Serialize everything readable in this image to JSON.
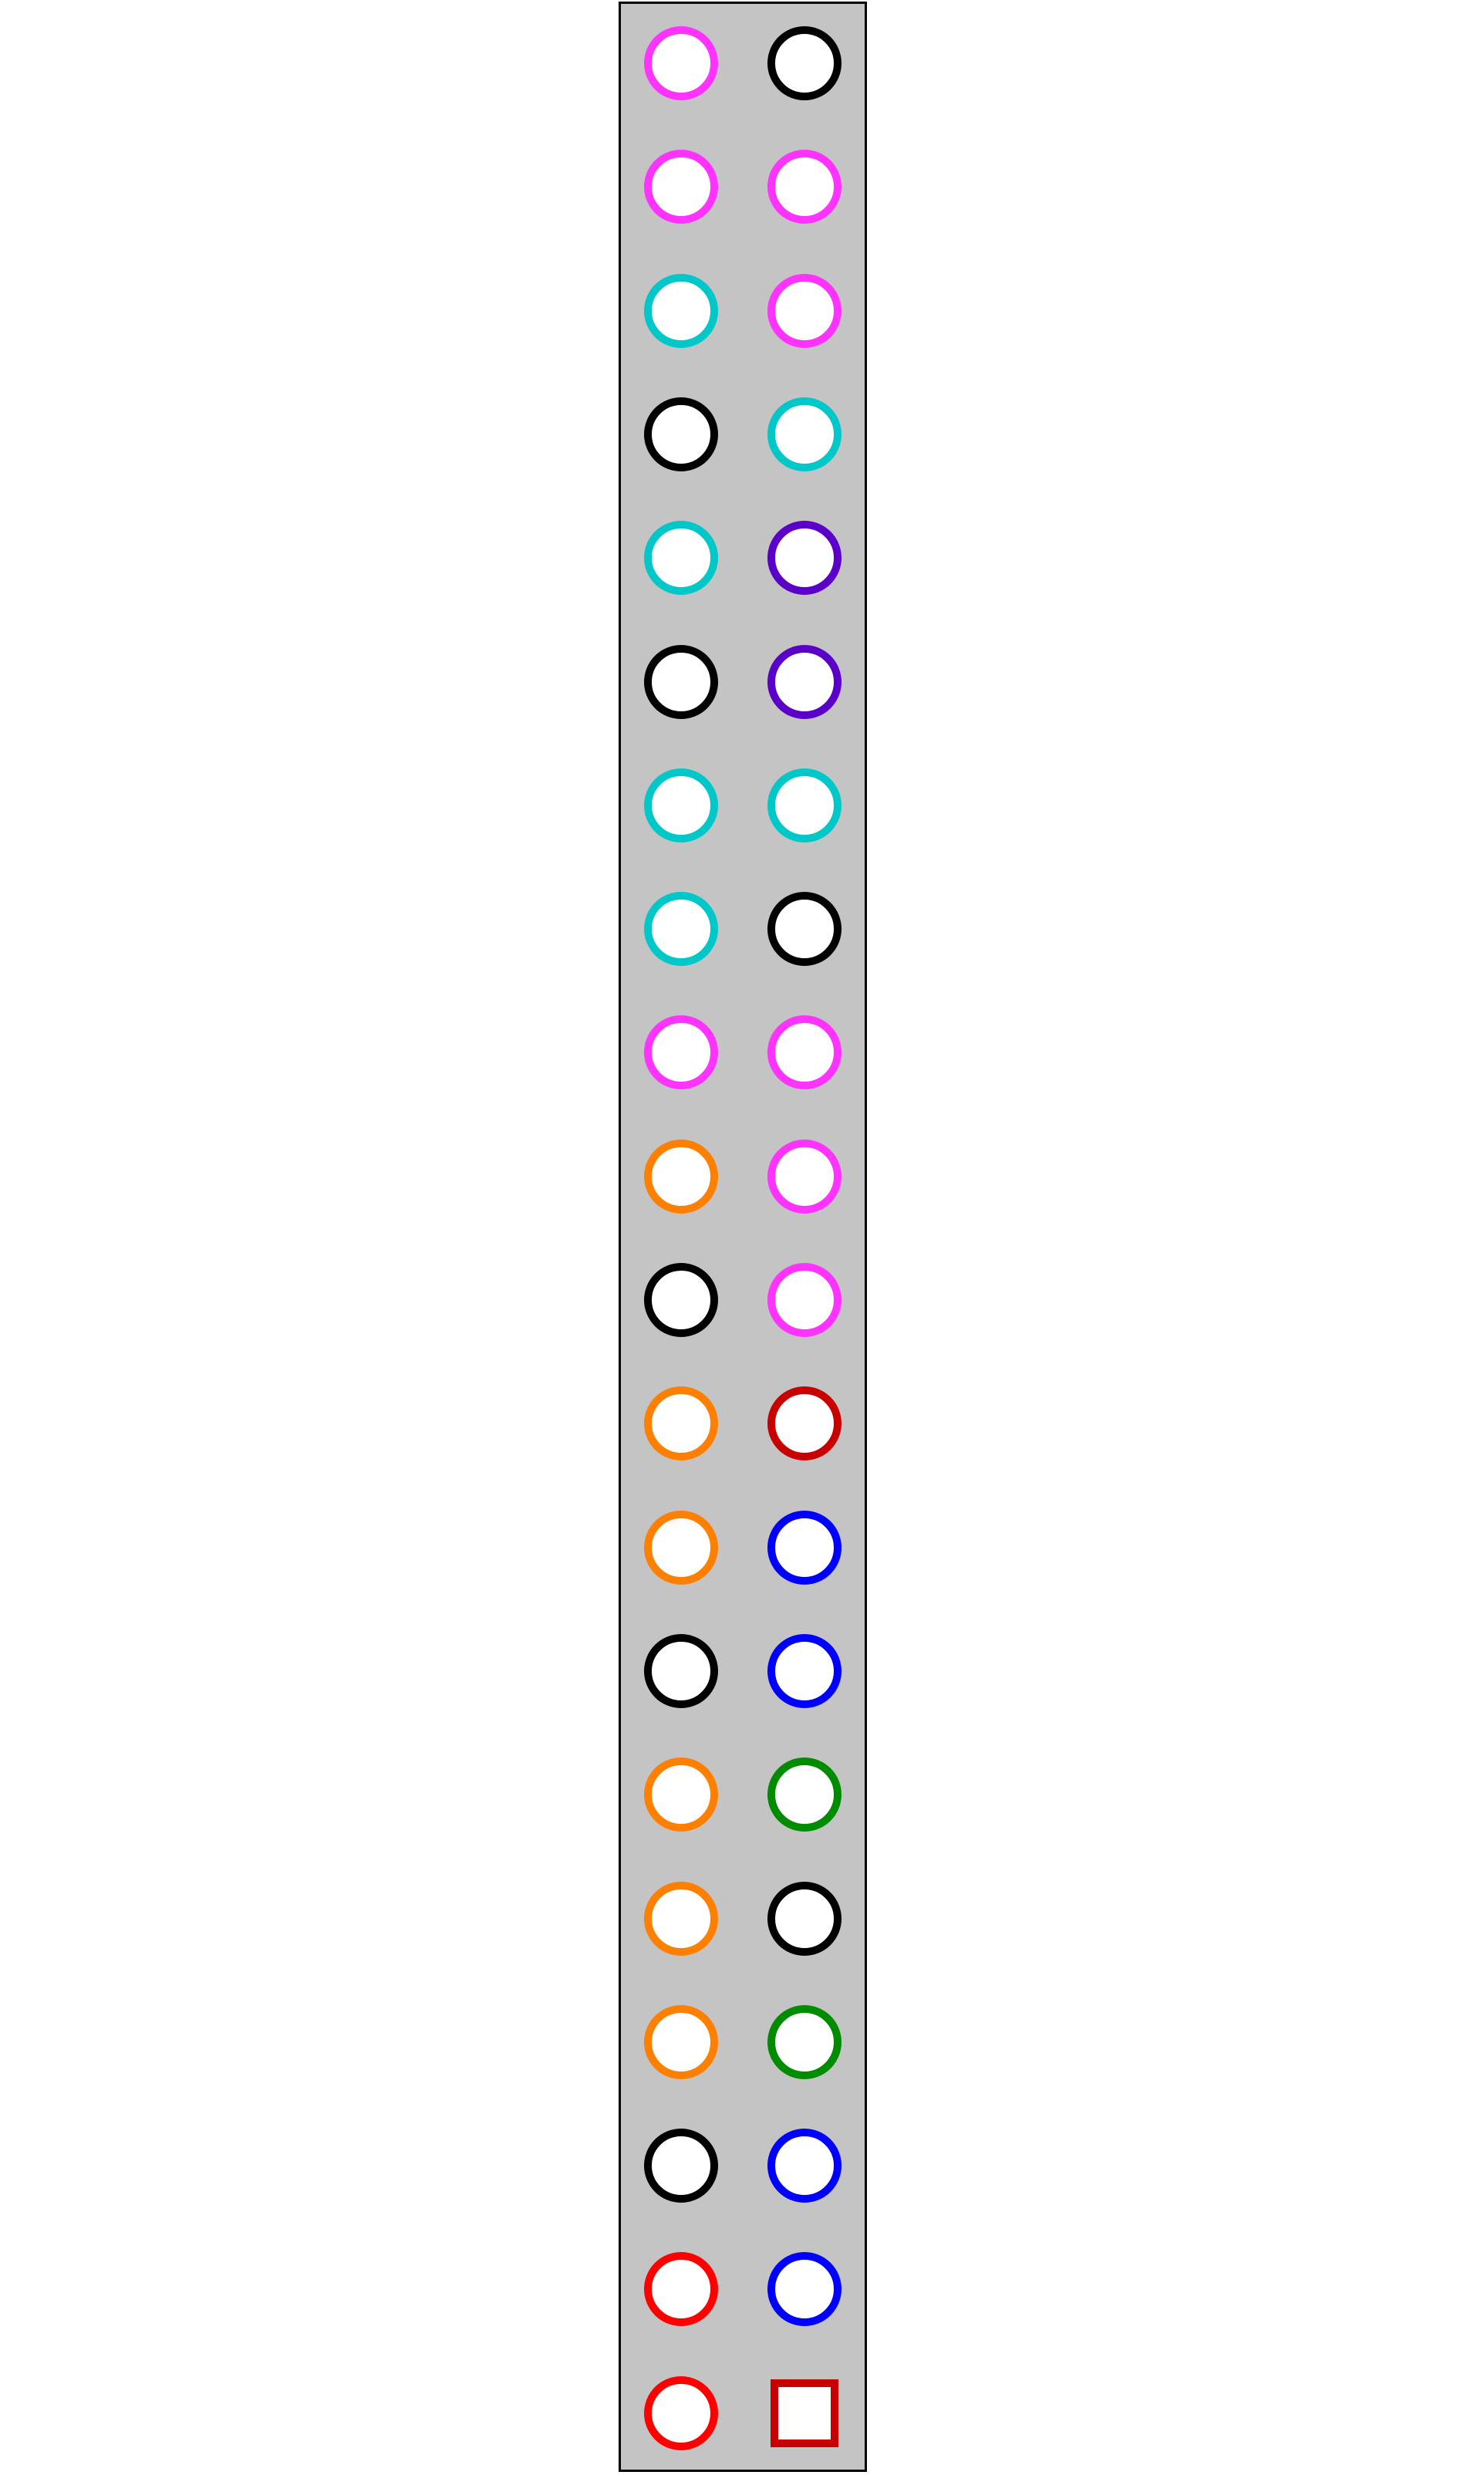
{
  "colors": {
    "magenta": "#ff33ff",
    "black": "#000000",
    "cyan": "#00c8c8",
    "purple": "#5b00c8",
    "orange": "#ff7f00",
    "darkred": "#c80000",
    "blue": "#0000ff",
    "green": "#008c00",
    "red": "#ff0000",
    "panel_background": "#c4c4c4",
    "panel_border": "#000000",
    "marker_fill": "#ffffff"
  },
  "columns": [
    {
      "name": "left",
      "markers": [
        {
          "shape": "circle",
          "color": "magenta"
        },
        {
          "shape": "circle",
          "color": "magenta"
        },
        {
          "shape": "circle",
          "color": "cyan"
        },
        {
          "shape": "circle",
          "color": "black"
        },
        {
          "shape": "circle",
          "color": "cyan"
        },
        {
          "shape": "circle",
          "color": "black"
        },
        {
          "shape": "circle",
          "color": "cyan"
        },
        {
          "shape": "circle",
          "color": "cyan"
        },
        {
          "shape": "circle",
          "color": "magenta"
        },
        {
          "shape": "circle",
          "color": "orange"
        },
        {
          "shape": "circle",
          "color": "black"
        },
        {
          "shape": "circle",
          "color": "orange"
        },
        {
          "shape": "circle",
          "color": "orange"
        },
        {
          "shape": "circle",
          "color": "black"
        },
        {
          "shape": "circle",
          "color": "orange"
        },
        {
          "shape": "circle",
          "color": "orange"
        },
        {
          "shape": "circle",
          "color": "orange"
        },
        {
          "shape": "circle",
          "color": "black"
        },
        {
          "shape": "circle",
          "color": "red"
        },
        {
          "shape": "circle",
          "color": "red"
        }
      ]
    },
    {
      "name": "right",
      "markers": [
        {
          "shape": "circle",
          "color": "black"
        },
        {
          "shape": "circle",
          "color": "magenta"
        },
        {
          "shape": "circle",
          "color": "magenta"
        },
        {
          "shape": "circle",
          "color": "cyan"
        },
        {
          "shape": "circle",
          "color": "purple"
        },
        {
          "shape": "circle",
          "color": "purple"
        },
        {
          "shape": "circle",
          "color": "cyan"
        },
        {
          "shape": "circle",
          "color": "black"
        },
        {
          "shape": "circle",
          "color": "magenta"
        },
        {
          "shape": "circle",
          "color": "magenta"
        },
        {
          "shape": "circle",
          "color": "magenta"
        },
        {
          "shape": "circle",
          "color": "darkred"
        },
        {
          "shape": "circle",
          "color": "blue"
        },
        {
          "shape": "circle",
          "color": "blue"
        },
        {
          "shape": "circle",
          "color": "green"
        },
        {
          "shape": "circle",
          "color": "black"
        },
        {
          "shape": "circle",
          "color": "green"
        },
        {
          "shape": "circle",
          "color": "blue"
        },
        {
          "shape": "circle",
          "color": "blue"
        },
        {
          "shape": "square",
          "color": "darkred"
        }
      ]
    }
  ]
}
